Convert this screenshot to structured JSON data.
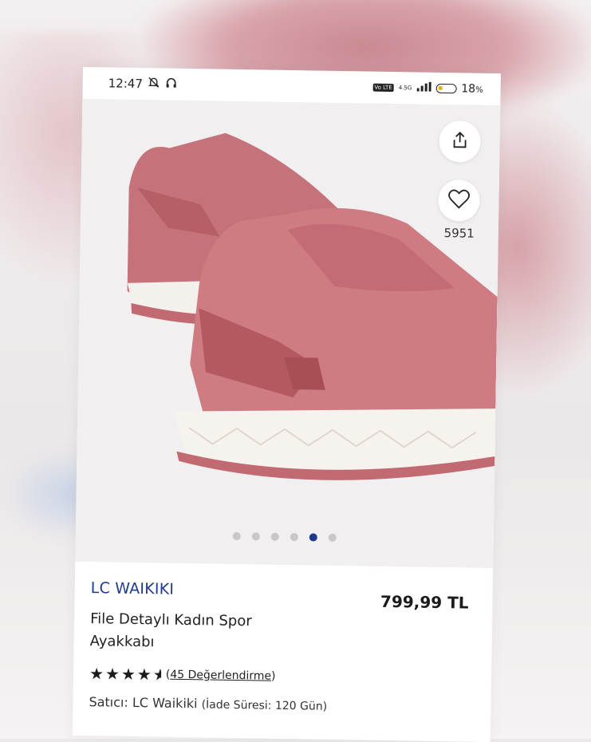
{
  "status": {
    "time": "12:47",
    "network": "4.5G",
    "volte": "Vo LTE",
    "battery": "18",
    "battery_unit": "%"
  },
  "product": {
    "favorites_count": "5951",
    "images": {
      "count": 6,
      "active_index": 4
    },
    "brand": "LC WAIKIKI",
    "price": "799,99 TL",
    "title": "File Detaylı Kadın Spor Ayakkabı",
    "rating": 4.5,
    "stars_text": "★★★★",
    "reviews_label": "45 Değerlendirme",
    "seller_label": "Satıcı: LC Waikiki",
    "return_policy": "(İade Süresi: 120 Gün)"
  },
  "colors": {
    "brand_blue": "#1f3b8f",
    "active_dot": "#1d3a8a",
    "shoe_pink": "#c9737a"
  }
}
